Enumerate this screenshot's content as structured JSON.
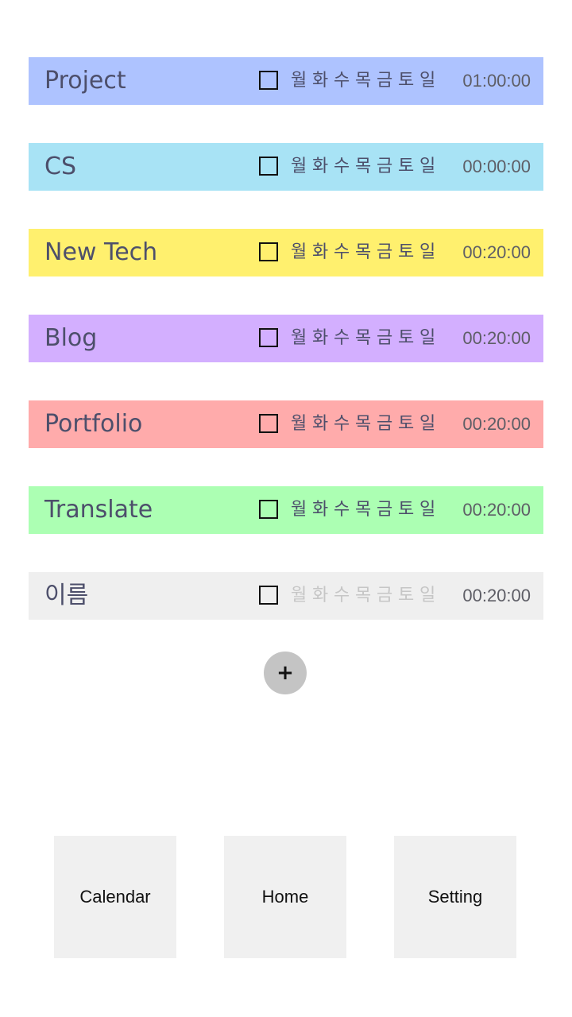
{
  "tasks": [
    {
      "name": "Project",
      "time": "01:00:00",
      "color": "#aec3ff",
      "days_muted": false
    },
    {
      "name": "CS",
      "time": "00:00:00",
      "color": "#a8e3f5",
      "days_muted": false
    },
    {
      "name": "New Tech",
      "time": "00:20:00",
      "color": "#fff06e",
      "days_muted": false
    },
    {
      "name": "Blog",
      "time": "00:20:00",
      "color": "#d3afff",
      "days_muted": false
    },
    {
      "name": "Portfolio",
      "time": "00:20:00",
      "color": "#ffabab",
      "days_muted": false
    },
    {
      "name": "Translate",
      "time": "00:20:00",
      "color": "#acffb3",
      "days_muted": false
    },
    {
      "name": "이름",
      "time": "00:20:00",
      "color": "#efefef",
      "days_muted": true
    }
  ],
  "weekdays": [
    "월",
    "화",
    "수",
    "목",
    "금",
    "토",
    "일"
  ],
  "add_label": "+",
  "nav": {
    "calendar_label": "Calendar",
    "home_label": "Home",
    "setting_label": "Setting"
  },
  "icons": {
    "add": "plus-icon"
  }
}
